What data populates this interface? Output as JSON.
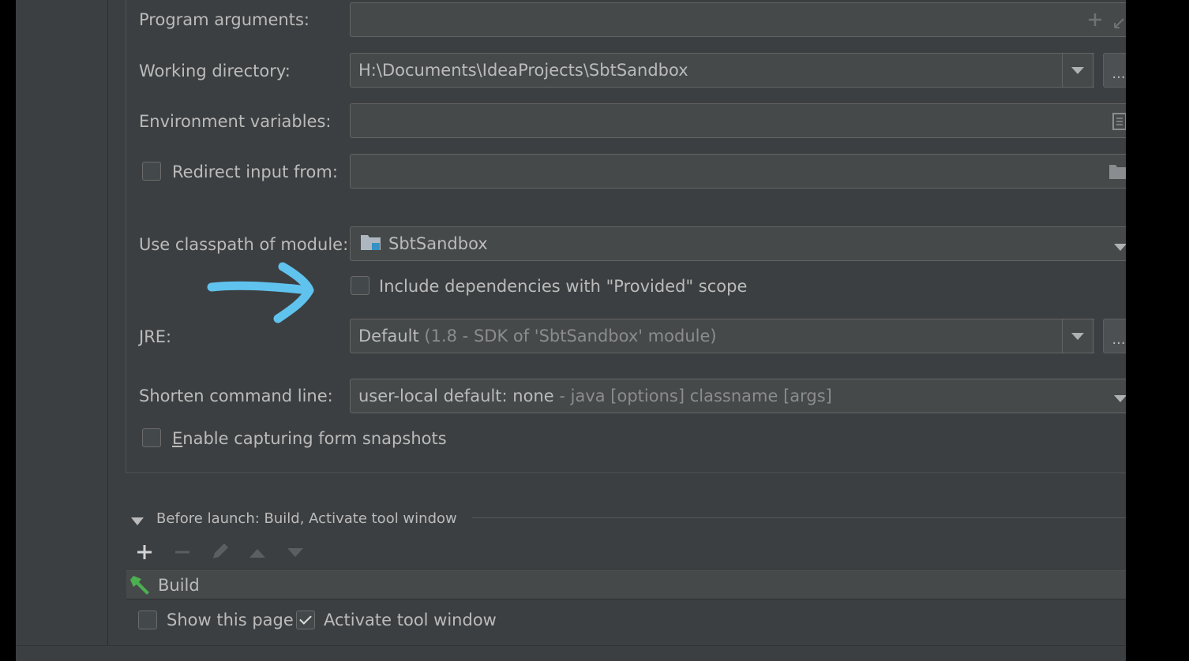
{
  "form": {
    "program_arguments": {
      "label": "Program arguments:",
      "value": ""
    },
    "working_directory": {
      "label": "Working directory:",
      "value": "H:\\Documents\\IdeaProjects\\SbtSandbox",
      "browse": "..."
    },
    "environment_variables": {
      "label": "Environment variables:",
      "value": ""
    },
    "redirect_input": {
      "label": "Redirect input from:",
      "checked": false,
      "value": ""
    },
    "classpath_module": {
      "label": "Use classpath of module:",
      "value": "SbtSandbox"
    },
    "include_provided": {
      "label": "Include dependencies with \"Provided\" scope",
      "checked": false
    },
    "jre": {
      "label": "JRE:",
      "value": "Default",
      "hint": "(1.8 - SDK of 'SbtSandbox' module)",
      "browse": "..."
    },
    "shorten_command_line": {
      "label": "Shorten command line:",
      "value": "user-local default: none",
      "hint": "- java [options] classname [args]"
    },
    "capture_snapshots": {
      "label_first": "E",
      "label_rest": "nable capturing form snapshots",
      "checked": false
    }
  },
  "before_launch": {
    "title": "Before launch: Build, Activate tool window",
    "items": [
      {
        "label": "Build"
      }
    ],
    "show_this_page": {
      "label": "Show this page",
      "checked": false
    },
    "activate_tool_window": {
      "label": "Activate tool window",
      "checked": true
    }
  },
  "colors": {
    "background": "#3c3f41",
    "field": "#45494a",
    "text": "#bbbbbb",
    "annotation_arrow": "#5fc3ee",
    "build_icon": "#4caf50"
  }
}
